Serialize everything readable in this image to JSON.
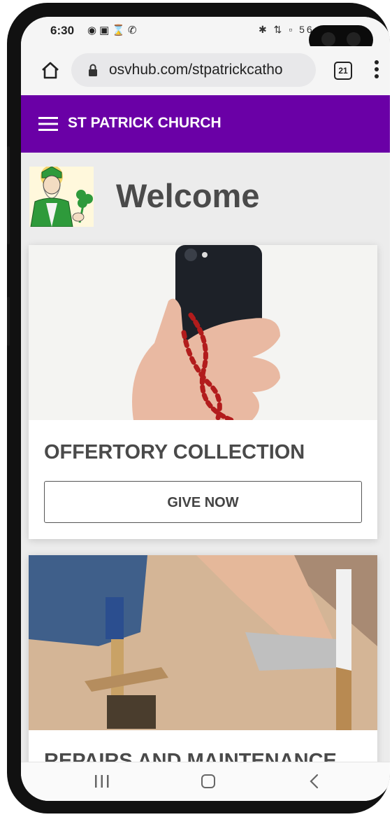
{
  "status_bar": {
    "time": "6:30",
    "left_icons": [
      "spotify-icon",
      "instagram-icon",
      "hourglass-icon",
      "whatsapp-icon"
    ],
    "right_text": "56"
  },
  "browser": {
    "url": "osvhub.com/stpatrickcatho",
    "tab_count": "21"
  },
  "header": {
    "title": "ST PATRICK CHURCH",
    "color": "#6a00a6"
  },
  "main": {
    "welcome": "Welcome",
    "cards": [
      {
        "title": "OFFERTORY COLLECTION",
        "button_label": "GIVE NOW",
        "image": "hand-holding-phone-with-rosary"
      },
      {
        "title": "REPAIRS AND MAINTENANCE",
        "image": "worker-measuring-floor-with-hammer"
      }
    ]
  }
}
